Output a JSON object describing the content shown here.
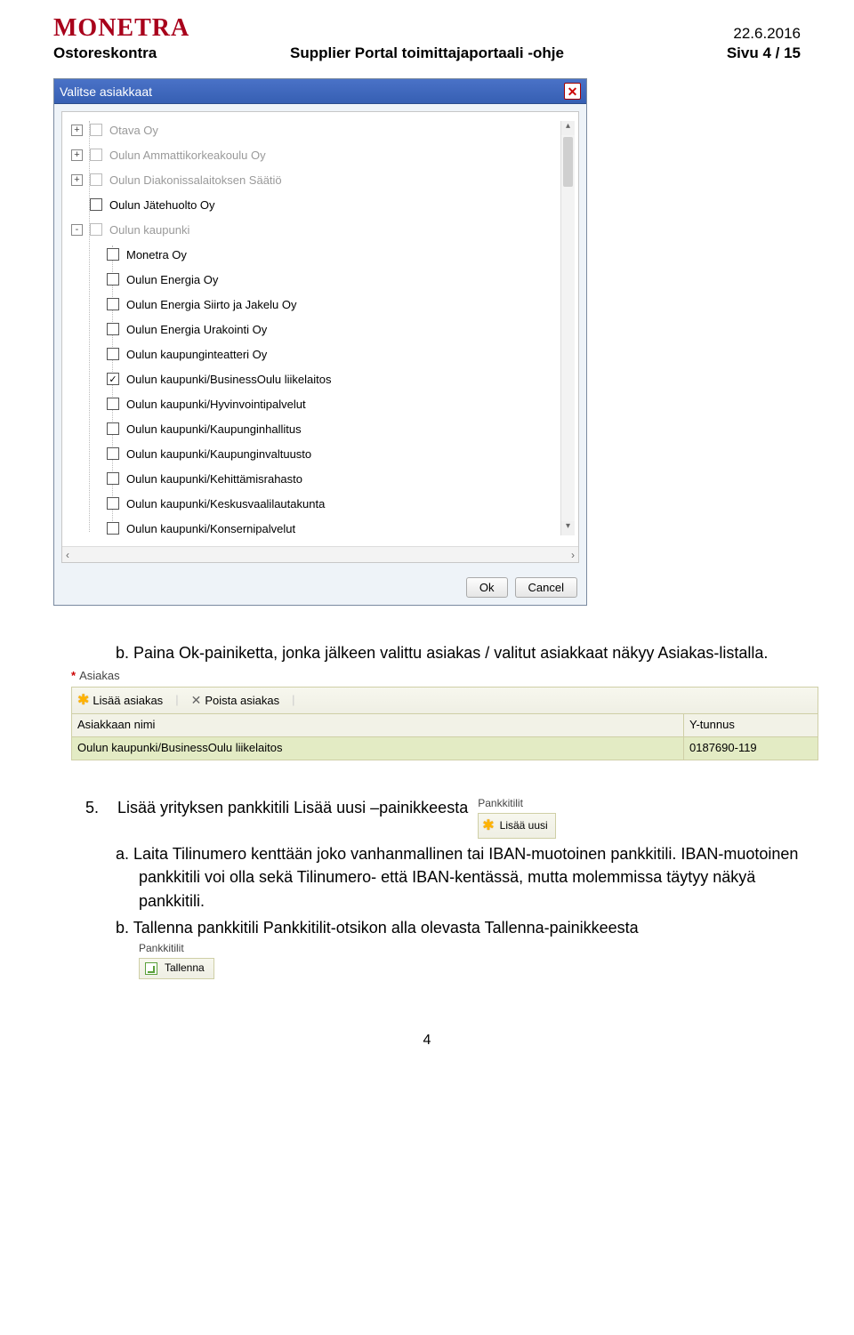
{
  "header": {
    "logo": "MONETRA",
    "date": "22.6.2016",
    "left": "Ostoreskontra",
    "center": "Supplier Portal toimittajaportaali -ohje",
    "right": "Sivu 4 / 15"
  },
  "dialog": {
    "title": "Valitse asiakkaat",
    "ok": "Ok",
    "cancel": "Cancel",
    "tree": [
      {
        "level": 0,
        "expander": "+",
        "checked": false,
        "label": "Otava Oy",
        "dim": true
      },
      {
        "level": 0,
        "expander": "+",
        "checked": false,
        "label": "Oulun Ammattikorkeakoulu Oy",
        "dim": true
      },
      {
        "level": 0,
        "expander": "+",
        "checked": false,
        "label": "Oulun Diakonissalaitoksen Säätiö",
        "dim": true
      },
      {
        "level": 0,
        "expander": "",
        "checked": false,
        "label": "Oulun Jätehuolto Oy",
        "dim": false
      },
      {
        "level": 0,
        "expander": "-",
        "checked": false,
        "label": "Oulun kaupunki",
        "dim": true
      },
      {
        "level": 1,
        "expander": "",
        "checked": false,
        "label": "Monetra Oy",
        "dim": false
      },
      {
        "level": 1,
        "expander": "",
        "checked": false,
        "label": "Oulun Energia Oy",
        "dim": false
      },
      {
        "level": 1,
        "expander": "",
        "checked": false,
        "label": "Oulun Energia Siirto ja Jakelu Oy",
        "dim": false
      },
      {
        "level": 1,
        "expander": "",
        "checked": false,
        "label": "Oulun Energia Urakointi Oy",
        "dim": false
      },
      {
        "level": 1,
        "expander": "",
        "checked": false,
        "label": "Oulun kaupunginteatteri Oy",
        "dim": false
      },
      {
        "level": 1,
        "expander": "",
        "checked": true,
        "label": "Oulun kaupunki/BusinessOulu liikelaitos",
        "dim": false
      },
      {
        "level": 1,
        "expander": "",
        "checked": false,
        "label": "Oulun kaupunki/Hyvinvointipalvelut",
        "dim": false
      },
      {
        "level": 1,
        "expander": "",
        "checked": false,
        "label": "Oulun kaupunki/Kaupunginhallitus",
        "dim": false
      },
      {
        "level": 1,
        "expander": "",
        "checked": false,
        "label": "Oulun kaupunki/Kaupunginvaltuusto",
        "dim": false
      },
      {
        "level": 1,
        "expander": "",
        "checked": false,
        "label": "Oulun kaupunki/Kehittämisrahasto",
        "dim": false
      },
      {
        "level": 1,
        "expander": "",
        "checked": false,
        "label": "Oulun kaupunki/Keskusvaalilautakunta",
        "dim": false
      },
      {
        "level": 1,
        "expander": "",
        "checked": false,
        "label": "Oulun kaupunki/Konsernipalvelut",
        "dim": false
      }
    ]
  },
  "text": {
    "b1": "b.  Paina Ok-painiketta, jonka jälkeen valittu asiakas / valitut asiakkaat näkyy Asiakas-listalla.",
    "num5": "5.",
    "num5_text": "Lisää yrityksen pankkitili Lisää uusi –painikkeesta",
    "a_text": "a.  Laita Tilinumero kenttään joko vanhanmallinen tai IBAN-muotoinen pankkitili. IBAN-muotoinen pankkitili voi olla sekä Tilinumero- että IBAN-kentässä, mutta molemmissa täytyy näkyä pankkitili.",
    "b2": "b.  Tallenna pankkitili Pankkitilit-otsikon alla olevasta Tallenna-painikkeesta"
  },
  "snippet_asiakas": {
    "title": "Asiakas",
    "add": "Lisää asiakas",
    "remove": "Poista asiakas",
    "col1": "Asiakkaan nimi",
    "col2": "Y-tunnus",
    "row_name": "Oulun kaupunki/BusinessOulu liikelaitos",
    "row_y": "0187690-119"
  },
  "snippet_pankki": {
    "title": "Pankkitilit",
    "link": "Lisää uusi"
  },
  "snippet_tallenna": {
    "title": "Pankkitilit",
    "btn": "Tallenna"
  },
  "page_num": "4"
}
